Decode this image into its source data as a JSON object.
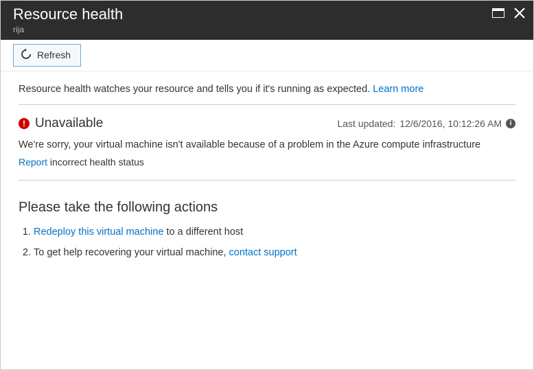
{
  "header": {
    "title": "Resource health",
    "subtitle": "rija"
  },
  "toolbar": {
    "refresh_label": "Refresh"
  },
  "intro": {
    "text": "Resource health watches your resource and tells you if it's running as expected. ",
    "learn_more": "Learn more"
  },
  "status": {
    "name": "Unavailable",
    "updated_prefix": "Last updated: ",
    "updated_value": "12/6/2016, 10:12:26 AM",
    "message": "We're sorry, your virtual machine isn't available because of a problem in the Azure compute infrastructure",
    "report_link": "Report",
    "report_rest": " incorrect health status"
  },
  "actions": {
    "heading": "Please take the following actions",
    "items": [
      {
        "link": "Redeploy this virtual machine",
        "rest": " to a different host"
      },
      {
        "pre": "To get help recovering your virtual machine, ",
        "link": "contact support"
      }
    ]
  }
}
